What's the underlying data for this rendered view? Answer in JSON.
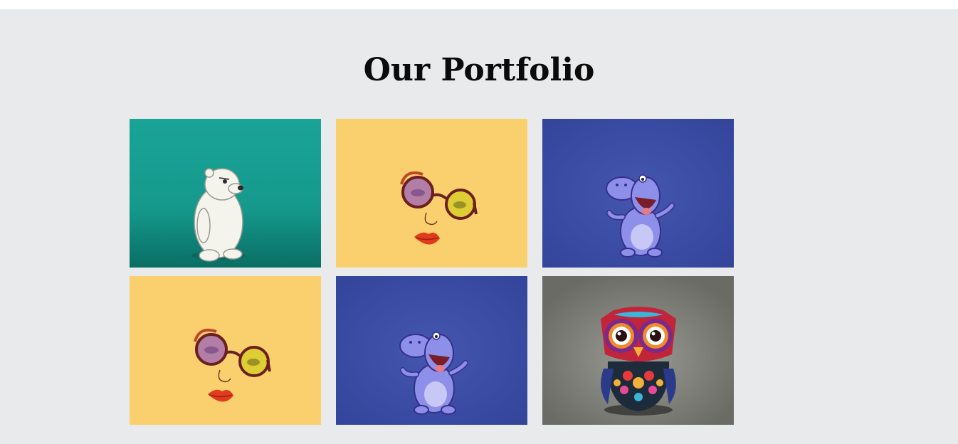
{
  "portfolio": {
    "title": "Our Portfolio",
    "items": [
      {
        "subject": "polar-bear",
        "background": "#17a397"
      },
      {
        "subject": "face-glasses-lips",
        "background": "#fad06f"
      },
      {
        "subject": "hippo",
        "background": "#3d4ea4"
      },
      {
        "subject": "face-glasses-lips",
        "background": "#fad06f"
      },
      {
        "subject": "hippo",
        "background": "#3d4ea4"
      },
      {
        "subject": "owl",
        "background": "#6d6e68"
      }
    ]
  }
}
